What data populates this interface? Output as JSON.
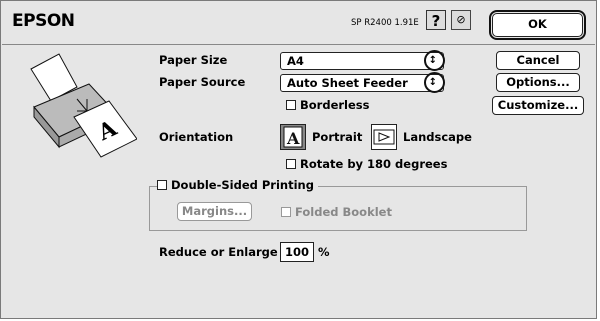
{
  "header": {
    "brand": "EPSON",
    "version": "SP R2400 1.91E",
    "help_glyph": "?",
    "tool_glyph": "⊘"
  },
  "buttons": {
    "ok": "OK",
    "cancel": "Cancel",
    "options": "Options...",
    "customize": "Customize..."
  },
  "paper_size": {
    "label": "Paper Size",
    "value": "A4",
    "arrows": "↕"
  },
  "paper_source": {
    "label": "Paper Source",
    "value": "Auto Sheet Feeder",
    "arrows": "↕"
  },
  "borderless": {
    "label": "Borderless",
    "checked": false
  },
  "orientation": {
    "label": "Orientation",
    "portrait": "Portrait",
    "landscape": "Landscape",
    "selected": "Portrait"
  },
  "rotate": {
    "label": "Rotate by 180 degrees",
    "checked": false
  },
  "double_sided": {
    "label": "Double-Sided Printing",
    "checked": false,
    "margins": "Margins...",
    "folded": "Folded Booklet"
  },
  "reduce": {
    "label": "Reduce or Enlarge",
    "value": "100",
    "unit": "%"
  },
  "icons": {
    "printer": "printer-illustration",
    "help": "help-icon",
    "tool": "tool-icon"
  }
}
